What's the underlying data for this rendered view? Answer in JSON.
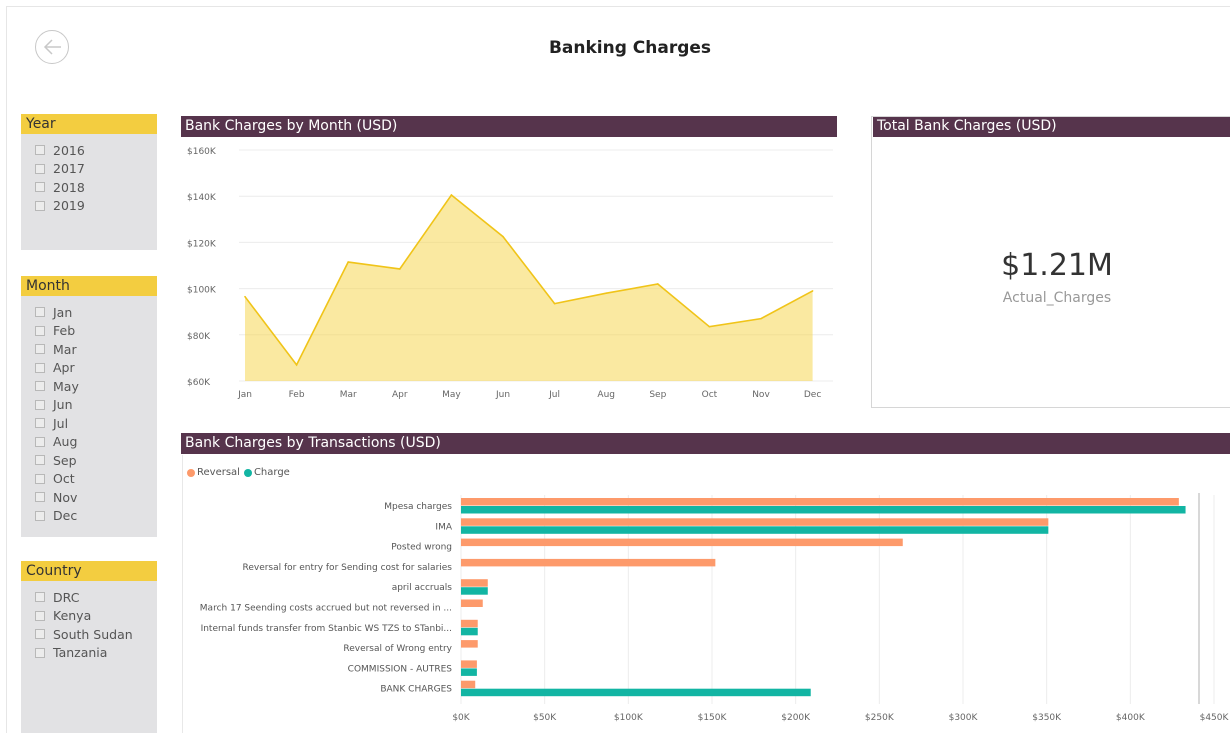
{
  "page": {
    "title": "Banking Charges"
  },
  "slicers": {
    "year": {
      "title": "Year",
      "items": [
        "2016",
        "2017",
        "2018",
        "2019"
      ]
    },
    "month": {
      "title": "Month",
      "items": [
        "Jan",
        "Feb",
        "Mar",
        "Apr",
        "May",
        "Jun",
        "Jul",
        "Aug",
        "Sep",
        "Oct",
        "Nov",
        "Dec"
      ]
    },
    "country": {
      "title": "Country",
      "items": [
        "DRC",
        "Kenya",
        "South Sudan",
        "Tanzania"
      ]
    }
  },
  "card": {
    "title": "Total Bank Charges (USD)",
    "value": "$1.21M",
    "label": "Actual_Charges"
  },
  "colors": {
    "accent": "#f3cd40",
    "header": "#56344c",
    "area": "#f5d343",
    "reversal": "#fd9a6b",
    "charge": "#12b5a3"
  },
  "chart_data": [
    {
      "type": "area",
      "title": "Bank Charges by Month (USD)",
      "categories": [
        "Jan",
        "Feb",
        "Mar",
        "Apr",
        "May",
        "Jun",
        "Jul",
        "Aug",
        "Sep",
        "Oct",
        "Nov",
        "Dec"
      ],
      "values": [
        96500,
        67000,
        111500,
        108500,
        140500,
        122500,
        93500,
        98000,
        102000,
        83500,
        87000,
        99000
      ],
      "yticks": [
        "$160K",
        "$140K",
        "$120K",
        "$100K",
        "$80K",
        "$60K"
      ],
      "ylim": [
        60000,
        160000
      ],
      "grid": true
    },
    {
      "type": "bar",
      "title": "Bank Charges by Transactions (USD)",
      "categories": [
        "Mpesa charges",
        "IMA",
        "Posted wrong",
        "Reversal for entry for Sending cost for salaries",
        "april accruals",
        "March 17 Seending costs accrued but not reversed in ...",
        "Internal funds transfer from Stanbic WS TZS to STanbi...",
        "Reversal of Wrong entry",
        "COMMISSION - AUTRES",
        "BANK CHARGES"
      ],
      "series": [
        {
          "name": "Reversal",
          "values": [
            429000,
            351000,
            264000,
            152000,
            16000,
            13000,
            10000,
            10000,
            9500,
            8500
          ]
        },
        {
          "name": "Charge",
          "values": [
            433000,
            351000,
            0,
            0,
            16000,
            0,
            10000,
            0,
            9500,
            209000
          ]
        }
      ],
      "xticks": [
        "$0K",
        "$50K",
        "$100K",
        "$150K",
        "$200K",
        "$250K",
        "$300K",
        "$350K",
        "$400K",
        "$450K"
      ],
      "xlim": [
        0,
        450000
      ],
      "legend": "top-left"
    }
  ]
}
